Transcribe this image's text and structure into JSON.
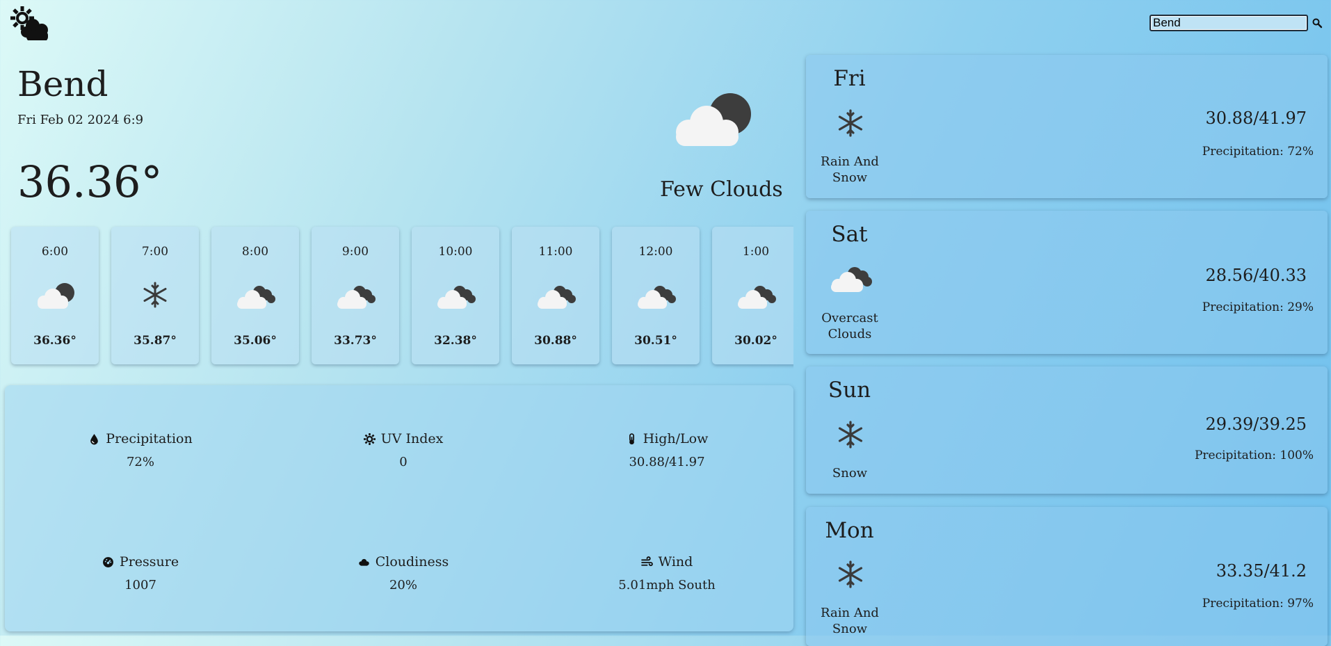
{
  "search": {
    "value": "Bend"
  },
  "current": {
    "city": "Bend",
    "datetime": "Fri Feb 02 2024 6:9",
    "temperature": "36.36°",
    "description": "Few Clouds",
    "icon": "few-clouds-night-icon"
  },
  "hourly": [
    {
      "time": "6:00",
      "temp": "36.36°",
      "icon": "few-clouds-night-icon"
    },
    {
      "time": "7:00",
      "temp": "35.87°",
      "icon": "snowflake-icon"
    },
    {
      "time": "8:00",
      "temp": "35.06°",
      "icon": "overcast-clouds-icon"
    },
    {
      "time": "9:00",
      "temp": "33.73°",
      "icon": "overcast-clouds-icon"
    },
    {
      "time": "10:00",
      "temp": "32.38°",
      "icon": "overcast-clouds-icon"
    },
    {
      "time": "11:00",
      "temp": "30.88°",
      "icon": "overcast-clouds-icon"
    },
    {
      "time": "12:00",
      "temp": "30.51°",
      "icon": "overcast-clouds-icon"
    },
    {
      "time": "1:00",
      "temp": "30.02°",
      "icon": "overcast-clouds-icon"
    }
  ],
  "details": {
    "precipitation": {
      "label": "Precipitation",
      "value": "72%",
      "icon": "water-drop-icon"
    },
    "uv_index": {
      "label": "UV Index",
      "value": "0",
      "icon": "sun-icon"
    },
    "high_low": {
      "label": "High/Low",
      "value": "30.88/41.97",
      "icon": "thermometer-icon"
    },
    "pressure": {
      "label": "Pressure",
      "value": "1007",
      "icon": "gauge-icon"
    },
    "cloudiness": {
      "label": "Cloudiness",
      "value": "20%",
      "icon": "cloud-icon"
    },
    "wind": {
      "label": "Wind",
      "value": "5.01mph South",
      "icon": "wind-icon"
    }
  },
  "daily": [
    {
      "day": "Fri",
      "desc_line1": "Rain And",
      "desc_line2": "Snow",
      "temp": "30.88/41.97",
      "precip": "Precipitation: 72%",
      "icon": "snowflake-icon"
    },
    {
      "day": "Sat",
      "desc_line1": "Overcast",
      "desc_line2": "Clouds",
      "temp": "28.56/40.33",
      "precip": "Precipitation: 29%",
      "icon": "overcast-clouds-icon"
    },
    {
      "day": "Sun",
      "desc_line1": "Snow",
      "desc_line2": "",
      "temp": "29.39/39.25",
      "precip": "Precipitation: 100%",
      "icon": "snowflake-icon"
    },
    {
      "day": "Mon",
      "desc_line1": "Rain And",
      "desc_line2": "Snow",
      "temp": "33.35/41.2",
      "precip": "Precipitation: 97%",
      "icon": "snowflake-icon"
    }
  ],
  "colors": {
    "cloud": "#f4f4f4",
    "dark_cloud": "#3d3d3d",
    "icon_gray": "#3a3a3a"
  }
}
